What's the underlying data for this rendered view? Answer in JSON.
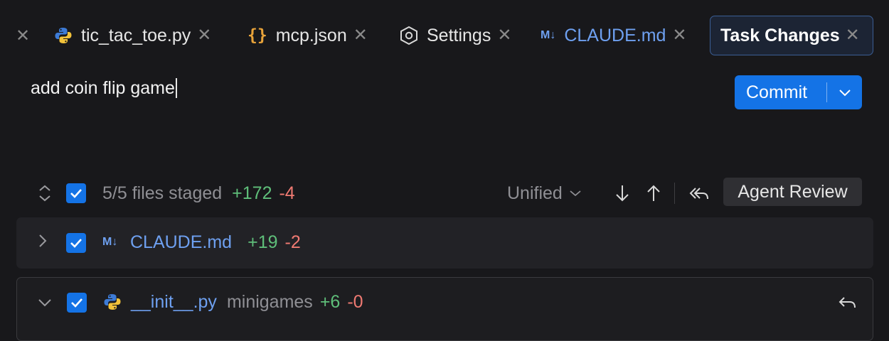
{
  "tabs": [
    {
      "label": "tic_tac_toe.py",
      "icon": "python-icon"
    },
    {
      "label": "mcp.json",
      "icon": "braces-icon"
    },
    {
      "label": "Settings",
      "icon": "hexagon-settings-icon"
    },
    {
      "label": "CLAUDE.md",
      "icon": "markdown-icon"
    },
    {
      "label": "Task Changes",
      "icon": "",
      "active": true
    }
  ],
  "commit_message": {
    "value": "add coin flip game"
  },
  "commit_button": {
    "label": "Commit"
  },
  "staging": {
    "summary": "5/5 files staged",
    "additions": "+172",
    "deletions": "-4",
    "view_mode": "Unified",
    "agent_review_label": "Agent Review"
  },
  "files": [
    {
      "name": "CLAUDE.md",
      "dir": "",
      "additions": "+19",
      "deletions": "-2",
      "expanded": false,
      "icon": "markdown-icon"
    },
    {
      "name": "__init__.py",
      "dir": "minigames",
      "additions": "+6",
      "deletions": "-0",
      "expanded": true,
      "icon": "python-icon"
    }
  ],
  "colors": {
    "accent": "#1473e6",
    "additions": "#5fbf7a",
    "deletions": "#f07a72",
    "link": "#6ea0f0",
    "background": "#18181b"
  }
}
